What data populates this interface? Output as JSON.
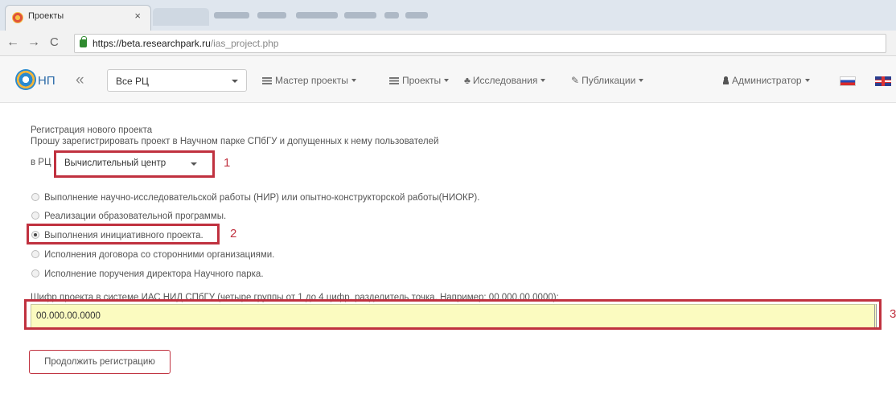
{
  "browser": {
    "tab_title": "Проекты",
    "tab_close": "×",
    "back": "←",
    "forward": "→",
    "reload": "C",
    "url_host": "https://beta.researchpark.ru",
    "url_path": "/ias_project.php"
  },
  "navbar": {
    "brand": "НП",
    "collapse": "«",
    "rc_selected": "Все РЦ",
    "menus": [
      {
        "label": "Мастер проекты"
      },
      {
        "label": "Проекты"
      },
      {
        "label": "Исследования"
      },
      {
        "label": "Публикации"
      }
    ],
    "user": "Администратор"
  },
  "form": {
    "heading": "Регистрация нового проекта",
    "intro": "Прошу зарегистрировать проект в Научном парке СПбГУ и допущенных к нему пользователей",
    "rc_label": "в РЦ",
    "rc_value": "Вычислительный центр",
    "options": [
      {
        "label": "Выполнение научно-исследовательской работы (НИР) или опытно-конструкторской работы(НИОКР).",
        "checked": false
      },
      {
        "label": "Реализации образовательной программы.",
        "checked": false
      },
      {
        "label": "Выполнения инициативного проекта.",
        "checked": true
      },
      {
        "label": "Исполнения договора со сторонними организациями.",
        "checked": false
      },
      {
        "label": "Исполнение поручения директора Научного парка.",
        "checked": false
      }
    ],
    "cipher_label": "Шифр проекта в системе ИАС НИД СПбГУ (четыре группы от 1 до 4 цифр, разделитель точка. Например: 00.000.00.0000):",
    "cipher_value": "00.000.00.0000",
    "continue_button": "Продолжить регистрацию"
  },
  "annotations": {
    "marker_1": "1",
    "marker_2": "2",
    "marker_3": "3",
    "color": "#c0313f"
  }
}
